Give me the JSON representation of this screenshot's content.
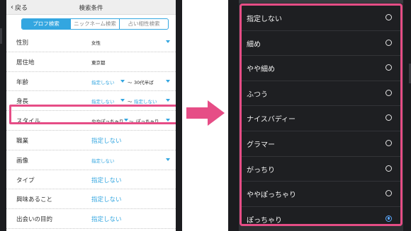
{
  "left": {
    "back_label": "戻る",
    "title": "検索条件",
    "tabs": [
      {
        "label": "プロフ検索",
        "active": true
      },
      {
        "label": "ニックネーム検索",
        "active": false
      },
      {
        "label": "占い相性検索",
        "active": false
      }
    ],
    "rows": [
      {
        "label": "性別",
        "value": "女性"
      },
      {
        "label": "居住地",
        "value": "東京都"
      },
      {
        "label": "年齢",
        "value_from": "指定しない",
        "sep": "〜",
        "value_to": "30代半ば"
      },
      {
        "label": "身長",
        "value_from": "指定しない",
        "sep": "〜",
        "value_to": "指定しない"
      },
      {
        "label": "スタイル",
        "value_from": "ややぽっちゃり",
        "sep": "〜",
        "value_to": "ぽっちゃり"
      },
      {
        "label": "職業",
        "value": "指定しない"
      },
      {
        "label": "画像",
        "value": "指定しない"
      },
      {
        "label": "タイプ",
        "value": "指定しない"
      },
      {
        "label": "興味あること",
        "value": "指定しない"
      },
      {
        "label": "出会いの目的",
        "value": "指定しない"
      }
    ]
  },
  "right": {
    "options": [
      {
        "label": "指定しない",
        "selected": false
      },
      {
        "label": "細め",
        "selected": false
      },
      {
        "label": "やや細め",
        "selected": false
      },
      {
        "label": "ふつう",
        "selected": false
      },
      {
        "label": "ナイスバディー",
        "selected": false
      },
      {
        "label": "グラマー",
        "selected": false
      },
      {
        "label": "がっちり",
        "selected": false
      },
      {
        "label": "ややぽっちゃり",
        "selected": false
      },
      {
        "label": "ぽっちゃり",
        "selected": true
      }
    ]
  },
  "colors": {
    "accent": "#33a6e0",
    "highlight": "#e64d86",
    "radio_selected": "#5aa8ff"
  }
}
